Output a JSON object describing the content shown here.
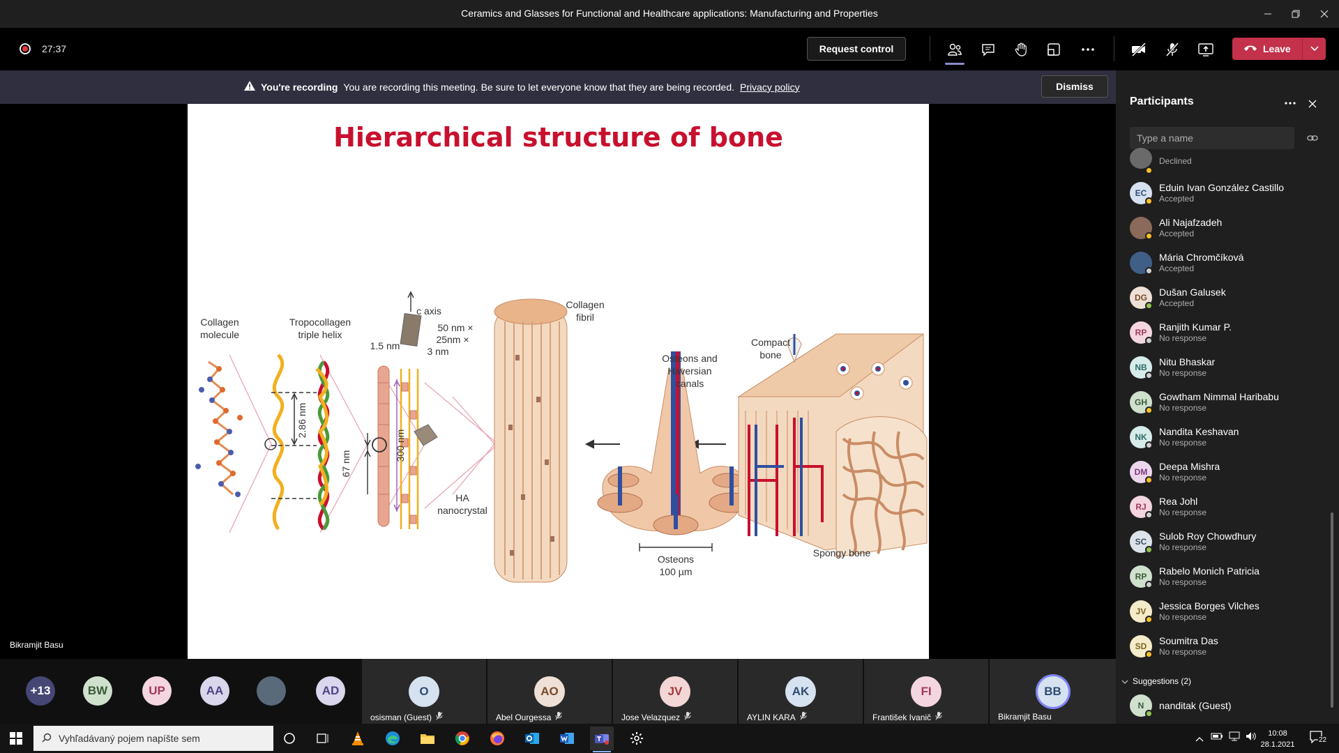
{
  "window": {
    "title": "Ceramics and Glasses for Functional and Healthcare applications: Manufacturing and Properties"
  },
  "toolbar": {
    "timer": "27:37",
    "request_control": "Request control",
    "leave": "Leave"
  },
  "banner": {
    "heading": "You're recording",
    "message": "You are recording this meeting. Be sure to let everyone know that they are being recorded.",
    "link": "Privacy policy",
    "dismiss": "Dismiss"
  },
  "slide": {
    "title": "Hierarchical structure of bone",
    "labels": {
      "collagen_molecule": [
        "Collagen",
        "molecule"
      ],
      "tropocollagen": [
        "Tropocollagen",
        "triple helix"
      ],
      "c_axis": "c axis",
      "crystal_dims": [
        "50 nm ×",
        "25nm ×",
        "3 nm"
      ],
      "d15": "1.5 nm",
      "d286": "2.86 nm",
      "d67": "67 nm",
      "d300": "300 nm",
      "ha": [
        "HA",
        "nanocrystal"
      ],
      "collagen_fibril": [
        "Collagen",
        "fibril"
      ],
      "osteons_canals": [
        "Osteons and",
        "Haversian",
        "canals"
      ],
      "osteons": [
        "Osteons",
        "100 µm"
      ],
      "compact_bone": [
        "Compact",
        "bone"
      ],
      "spongy_bone": "Spongy bone"
    },
    "presenter": "Bikramjit Basu"
  },
  "strip": {
    "mini": [
      {
        "initials": "+13",
        "color": "#464775",
        "fg": "#ffffff"
      },
      {
        "initials": "BW",
        "color": "#cfe0cd",
        "fg": "#3b5a38"
      },
      {
        "initials": "UP",
        "color": "#f3d6df",
        "fg": "#a23a5c"
      },
      {
        "initials": "AA",
        "color": "#dad6ec",
        "fg": "#4d4585"
      },
      {
        "initials": "",
        "color": "#5a6a7a",
        "fg": "#ffffff"
      },
      {
        "initials": "AD",
        "color": "#dad6ec",
        "fg": "#4d4585"
      }
    ],
    "tiles": [
      {
        "initials": "O",
        "name": "osisman (Guest)",
        "color": "#d6e2f0",
        "fg": "#2f4c73"
      },
      {
        "initials": "AO",
        "name": "Abel Ourgessa",
        "color": "#eee0d6",
        "fg": "#7a4a2b"
      },
      {
        "initials": "JV",
        "name": "Jose Velazquez",
        "color": "#f3d6d6",
        "fg": "#a23a3a"
      },
      {
        "initials": "AK",
        "name": "AYLIN KARA",
        "color": "#d6e2f0",
        "fg": "#2f4c73"
      },
      {
        "initials": "FI",
        "name": "František Ivanič",
        "color": "#f3d6df",
        "fg": "#a23a5c"
      },
      {
        "initials": "BB",
        "name": "Bikramjit Basu",
        "color": "#d6e2f0",
        "fg": "#2f4c73"
      }
    ]
  },
  "panel": {
    "title": "Participants",
    "search_placeholder": "Type a name",
    "people": [
      {
        "initials": "",
        "name": "",
        "status": "Declined",
        "color": "#6a6a6a",
        "fg": "#fff",
        "dot": "#f8c02b"
      },
      {
        "initials": "EC",
        "name": "Eduin Ivan González Castillo",
        "status": "Accepted",
        "color": "#d6e2f0",
        "fg": "#2f4c73",
        "dot": "#f8c02b"
      },
      {
        "initials": "",
        "name": "Ali Najafzadeh",
        "status": "Accepted",
        "color": "#8a6a5a",
        "fg": "#fff",
        "dot": "#f8c02b"
      },
      {
        "initials": "",
        "name": "Mária Chromčíková",
        "status": "Accepted",
        "color": "#3f5f86",
        "fg": "#fff",
        "dot": "#cfcfcf"
      },
      {
        "initials": "DG",
        "name": "Dušan Galusek",
        "status": "Accepted",
        "color": "#eee0d6",
        "fg": "#7a4a2b",
        "dot": "#92c353"
      },
      {
        "initials": "RP",
        "name": "Ranjith Kumar P.",
        "status": "No response",
        "color": "#f3d6df",
        "fg": "#a23a5c",
        "dot": "#cfcfcf"
      },
      {
        "initials": "NB",
        "name": "Nitu Bhaskar",
        "status": "No response",
        "color": "#d6ecea",
        "fg": "#2d6b66",
        "dot": "#cfcfcf"
      },
      {
        "initials": "GH",
        "name": "Gowtham Nimmal Haribabu",
        "status": "No response",
        "color": "#cfe0cd",
        "fg": "#3b5a38",
        "dot": "#f8c02b"
      },
      {
        "initials": "NK",
        "name": "Nandita Keshavan",
        "status": "No response",
        "color": "#d6ecea",
        "fg": "#2d6b66",
        "dot": "#cfcfcf"
      },
      {
        "initials": "DM",
        "name": "Deepa Mishra",
        "status": "No response",
        "color": "#ecd6ec",
        "fg": "#7a3a7a",
        "dot": "#f8c02b"
      },
      {
        "initials": "RJ",
        "name": "Rea Johl",
        "status": "No response",
        "color": "#f3d6df",
        "fg": "#a23a5c",
        "dot": "#cfcfcf"
      },
      {
        "initials": "SC",
        "name": "Sulob Roy Chowdhury",
        "status": "No response",
        "color": "#dde3ea",
        "fg": "#3f4f63",
        "dot": "#92c353"
      },
      {
        "initials": "RP",
        "name": "Rabelo Monich Patricia",
        "status": "No response",
        "color": "#cfe0cd",
        "fg": "#3b5a38",
        "dot": "#cfcfcf"
      },
      {
        "initials": "JV",
        "name": "Jessica Borges Vilches",
        "status": "No response",
        "color": "#f4ecc8",
        "fg": "#7a6420",
        "dot": "#f8c02b"
      },
      {
        "initials": "SD",
        "name": "Soumitra Das",
        "status": "No response",
        "color": "#f4ecc8",
        "fg": "#7a6420",
        "dot": "#f8c02b"
      }
    ],
    "suggestions_label": "Suggestions (2)",
    "suggestion": {
      "initials": "N",
      "name": "nanditak (Guest)",
      "color": "#cfe0cd",
      "fg": "#3b5a38",
      "dot": "#92c353"
    }
  },
  "taskbar": {
    "search_placeholder": "Vyhľadávaný pojem napíšte sem",
    "time": "10:08",
    "date": "28.1.2021",
    "notifications": "22"
  }
}
